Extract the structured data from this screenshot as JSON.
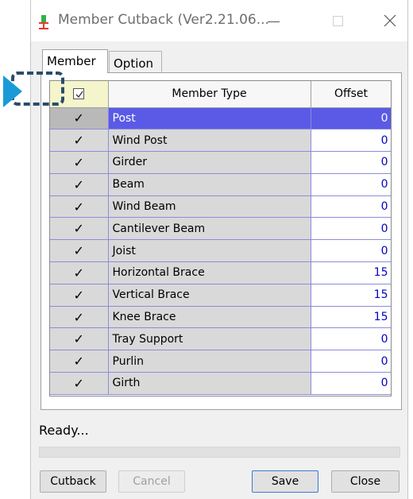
{
  "window": {
    "title": "Member Cutback (Ver2.21.06..."
  },
  "tabs": [
    {
      "label": "Member"
    },
    {
      "label": "Option"
    }
  ],
  "table": {
    "columns": {
      "check": "☑",
      "type": "Member Type",
      "offset": "Offset"
    },
    "rows": [
      {
        "checked": "✓",
        "type": "Post",
        "offset": "0"
      },
      {
        "checked": "✓",
        "type": "Wind Post",
        "offset": "0"
      },
      {
        "checked": "✓",
        "type": "Girder",
        "offset": "0"
      },
      {
        "checked": "✓",
        "type": "Beam",
        "offset": "0"
      },
      {
        "checked": "✓",
        "type": "Wind Beam",
        "offset": "0"
      },
      {
        "checked": "✓",
        "type": "Cantilever Beam",
        "offset": "0"
      },
      {
        "checked": "✓",
        "type": "Joist",
        "offset": "0"
      },
      {
        "checked": "✓",
        "type": "Horizontal Brace",
        "offset": "15"
      },
      {
        "checked": "✓",
        "type": "Vertical Brace",
        "offset": "15"
      },
      {
        "checked": "✓",
        "type": "Knee Brace",
        "offset": "15"
      },
      {
        "checked": "✓",
        "type": "Tray Support",
        "offset": "0"
      },
      {
        "checked": "✓",
        "type": "Purlin",
        "offset": "0"
      },
      {
        "checked": "✓",
        "type": "Girth",
        "offset": "0"
      }
    ],
    "selected_row": 0
  },
  "status": {
    "text": "Ready..."
  },
  "progress": {
    "value": 0
  },
  "buttons": {
    "cutback": "Cutback",
    "cancel": "Cancel",
    "save": "Save",
    "close": "Close"
  },
  "colors": {
    "selection": "#5a5ae6",
    "offset_text": "#0000c8",
    "annotation": "#2c4c6a",
    "arrow": "#1a9bd7"
  }
}
